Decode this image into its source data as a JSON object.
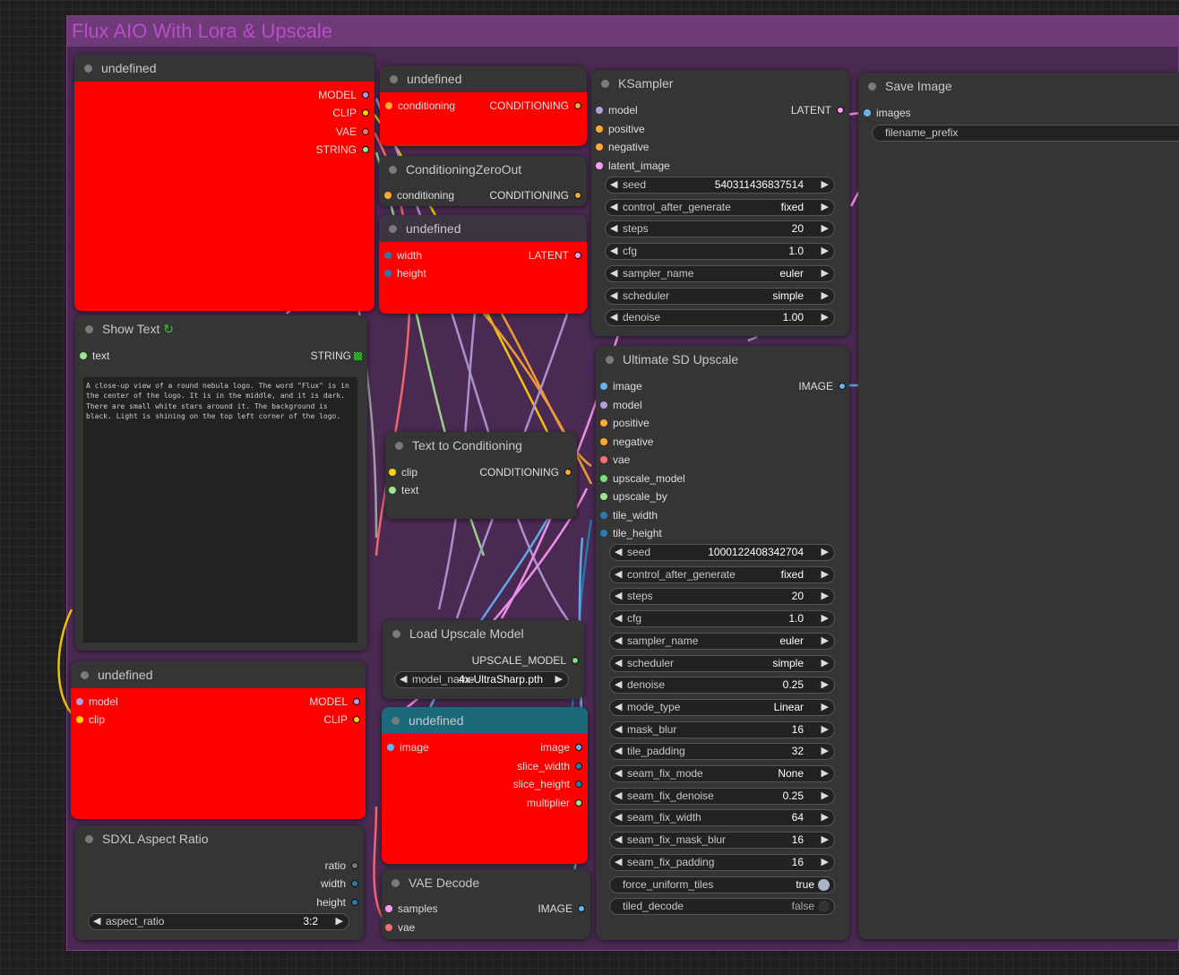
{
  "group": {
    "title": "Flux AIO With Lora & Upscale"
  },
  "colors": {
    "model": "#b39ddb",
    "clip": "#ffd500",
    "vae": "#ff6e6e",
    "string": "#9be88a",
    "conditioning": "#ffa931",
    "latent": "#ff9cf9",
    "image": "#64b5f6",
    "int": "#2a7ab0",
    "upscale_model": "#7ae07a"
  },
  "nodes": {
    "loader": {
      "title": "undefined",
      "outputs": [
        "MODEL",
        "CLIP",
        "VAE",
        "STRING"
      ]
    },
    "cond_top": {
      "title": "undefined",
      "input": "conditioning",
      "output": "CONDITIONING"
    },
    "czo": {
      "title": "ConditioningZeroOut",
      "input": "conditioning",
      "output": "CONDITIONING"
    },
    "latent": {
      "title": "undefined",
      "inputs": [
        "width",
        "height"
      ],
      "output": "LATENT"
    },
    "show_text": {
      "title": "Show Text",
      "input": "text",
      "output": "STRING",
      "content": "A close-up view of a round nebula logo. The word \"Flux\" is in the center of the logo. It is in the middle, and it is dark. There are small white stars around it. The background is black. Light is shining on the top left corner of the logo."
    },
    "lora": {
      "title": "undefined",
      "inputs": [
        "model",
        "clip"
      ],
      "outputs": [
        "MODEL",
        "CLIP"
      ]
    },
    "sdxl": {
      "title": "SDXL Aspect Ratio",
      "outputs": [
        "ratio",
        "width",
        "height"
      ],
      "widget": {
        "label": "aspect_ratio",
        "value": "3:2"
      }
    },
    "t2c": {
      "title": "Text to Conditioning",
      "inputs": [
        "clip",
        "text"
      ],
      "output": "CONDITIONING"
    },
    "upscale_loader": {
      "title": "Load Upscale Model",
      "output": "UPSCALE_MODEL",
      "widget": {
        "label": "model_name",
        "value": "4x-UltraSharp.pth"
      }
    },
    "slicer": {
      "title": "undefined",
      "input": "image",
      "outputs": [
        "image",
        "slice_width",
        "slice_height",
        "multiplier"
      ]
    },
    "vae_decode": {
      "title": "VAE Decode",
      "inputs": [
        "samples",
        "vae"
      ],
      "output": "IMAGE"
    },
    "ksampler": {
      "title": "KSampler",
      "inputs": [
        "model",
        "positive",
        "negative",
        "latent_image"
      ],
      "output": "LATENT",
      "widgets": [
        {
          "label": "seed",
          "value": "540311436837514"
        },
        {
          "label": "control_after_generate",
          "value": "fixed"
        },
        {
          "label": "steps",
          "value": "20"
        },
        {
          "label": "cfg",
          "value": "1.0"
        },
        {
          "label": "sampler_name",
          "value": "euler"
        },
        {
          "label": "scheduler",
          "value": "simple"
        },
        {
          "label": "denoise",
          "value": "1.00"
        }
      ]
    },
    "usd": {
      "title": "Ultimate SD Upscale",
      "inputs": [
        "image",
        "model",
        "positive",
        "negative",
        "vae",
        "upscale_model",
        "upscale_by",
        "tile_width",
        "tile_height"
      ],
      "output": "IMAGE",
      "widgets": [
        {
          "label": "seed",
          "value": "1000122408342704"
        },
        {
          "label": "control_after_generate",
          "value": "fixed"
        },
        {
          "label": "steps",
          "value": "20"
        },
        {
          "label": "cfg",
          "value": "1.0"
        },
        {
          "label": "sampler_name",
          "value": "euler"
        },
        {
          "label": "scheduler",
          "value": "simple"
        },
        {
          "label": "denoise",
          "value": "0.25"
        },
        {
          "label": "mode_type",
          "value": "Linear"
        },
        {
          "label": "mask_blur",
          "value": "16"
        },
        {
          "label": "tile_padding",
          "value": "32"
        },
        {
          "label": "seam_fix_mode",
          "value": "None"
        },
        {
          "label": "seam_fix_denoise",
          "value": "0.25"
        },
        {
          "label": "seam_fix_width",
          "value": "64"
        },
        {
          "label": "seam_fix_mask_blur",
          "value": "16"
        },
        {
          "label": "seam_fix_padding",
          "value": "16"
        }
      ],
      "toggles": [
        {
          "label": "force_uniform_tiles",
          "value": "true"
        },
        {
          "label": "tiled_decode",
          "value": "false"
        }
      ]
    },
    "save": {
      "title": "Save Image",
      "input": "images",
      "widget": {
        "label": "filename_prefix"
      }
    }
  }
}
